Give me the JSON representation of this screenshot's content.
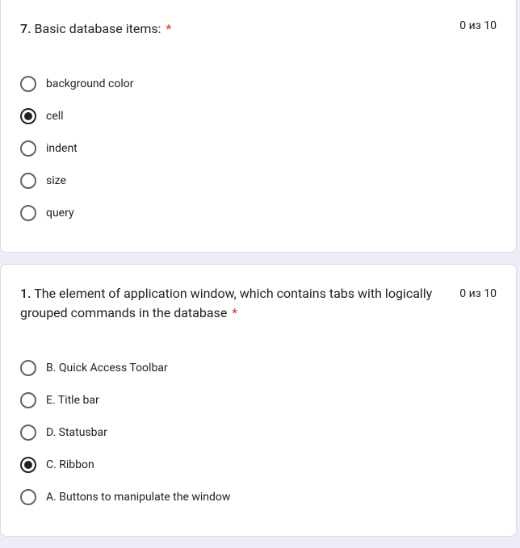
{
  "required_mark": "*",
  "questions": [
    {
      "number": "7.",
      "title": "Basic database items:",
      "score": "0 из 10",
      "score_wrap": false,
      "options": [
        {
          "label": "background color",
          "selected": false
        },
        {
          "label": "cell",
          "selected": true
        },
        {
          "label": "indent",
          "selected": false
        },
        {
          "label": "size",
          "selected": false
        },
        {
          "label": "query",
          "selected": false
        }
      ]
    },
    {
      "number": "1.",
      "title": "The element of application window, which contains tabs with logically grouped commands in the database",
      "score": "0 из 10",
      "score_wrap": true,
      "options": [
        {
          "label": "B. Quick Access Toolbar",
          "selected": false
        },
        {
          "label": "E. Title bar",
          "selected": false
        },
        {
          "label": "D. Statusbar",
          "selected": false
        },
        {
          "label": "C. Ribbon",
          "selected": true
        },
        {
          "label": "A. Buttons to manipulate the window",
          "selected": false
        }
      ]
    }
  ]
}
